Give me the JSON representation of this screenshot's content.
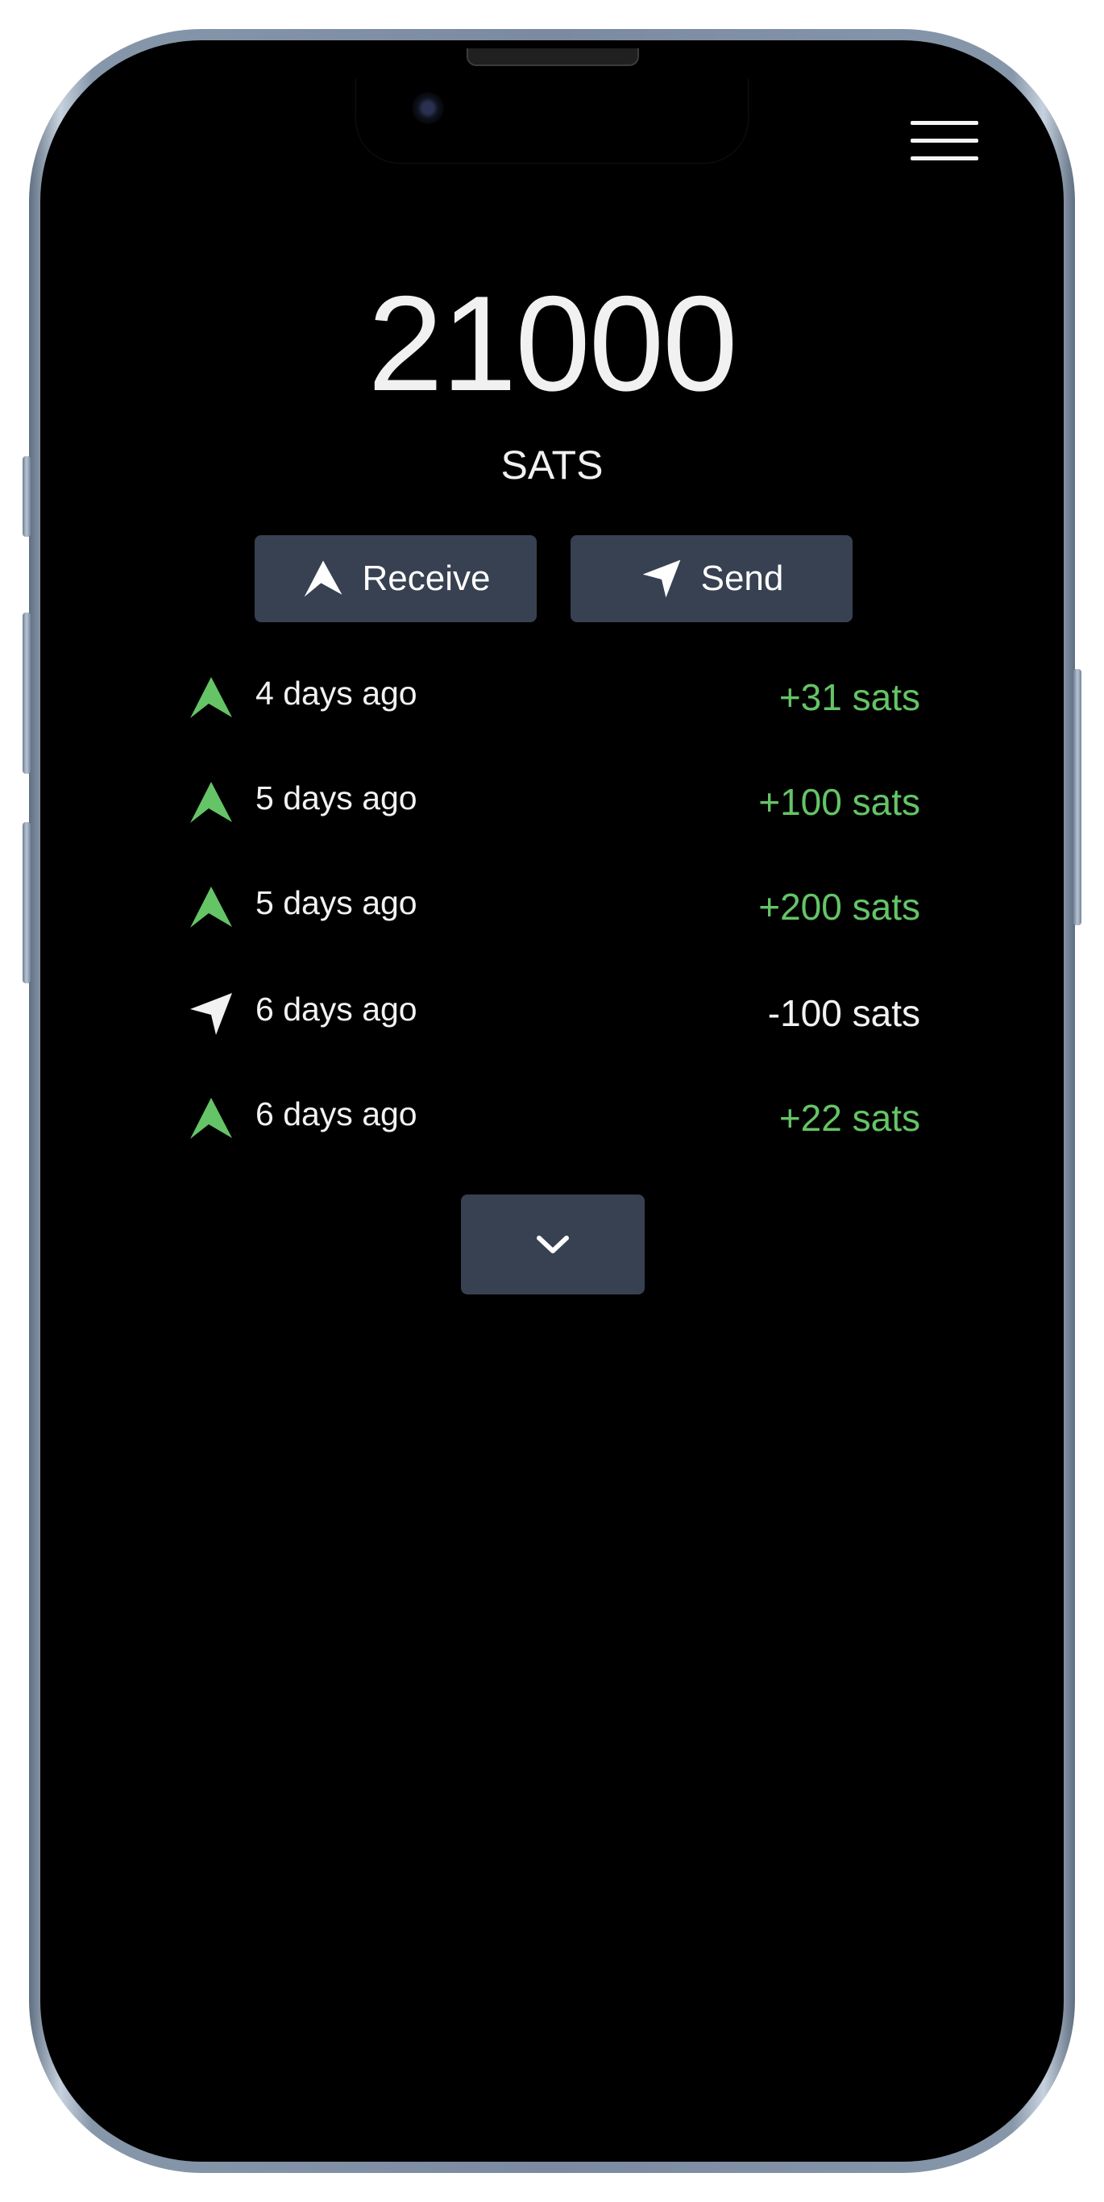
{
  "wallet": {
    "balance": "21000",
    "unit": "SATS",
    "receive_label": "Receive",
    "send_label": "Send"
  },
  "transactions": [
    {
      "time": "4 days ago",
      "amount": "+31 sats",
      "direction": "receive",
      "color": "#65c466"
    },
    {
      "time": "5 days ago",
      "amount": "+100 sats",
      "direction": "receive",
      "color": "#65c466"
    },
    {
      "time": "5 days ago",
      "amount": "+200 sats",
      "direction": "receive",
      "color": "#65c466"
    },
    {
      "time": "6 days ago",
      "amount": "-100 sats",
      "direction": "send",
      "color": "#f2f2f2"
    },
    {
      "time": "6 days ago",
      "amount": "+22 sats",
      "direction": "receive",
      "color": "#65c466"
    }
  ],
  "colors": {
    "positive": "#65c466",
    "negative": "#f2f2f2",
    "button_bg": "#374151"
  },
  "icons": {
    "menu": "hamburger-menu-icon",
    "receive": "receive-arrow-icon",
    "send": "send-arrow-icon",
    "more": "chevron-down-icon"
  }
}
